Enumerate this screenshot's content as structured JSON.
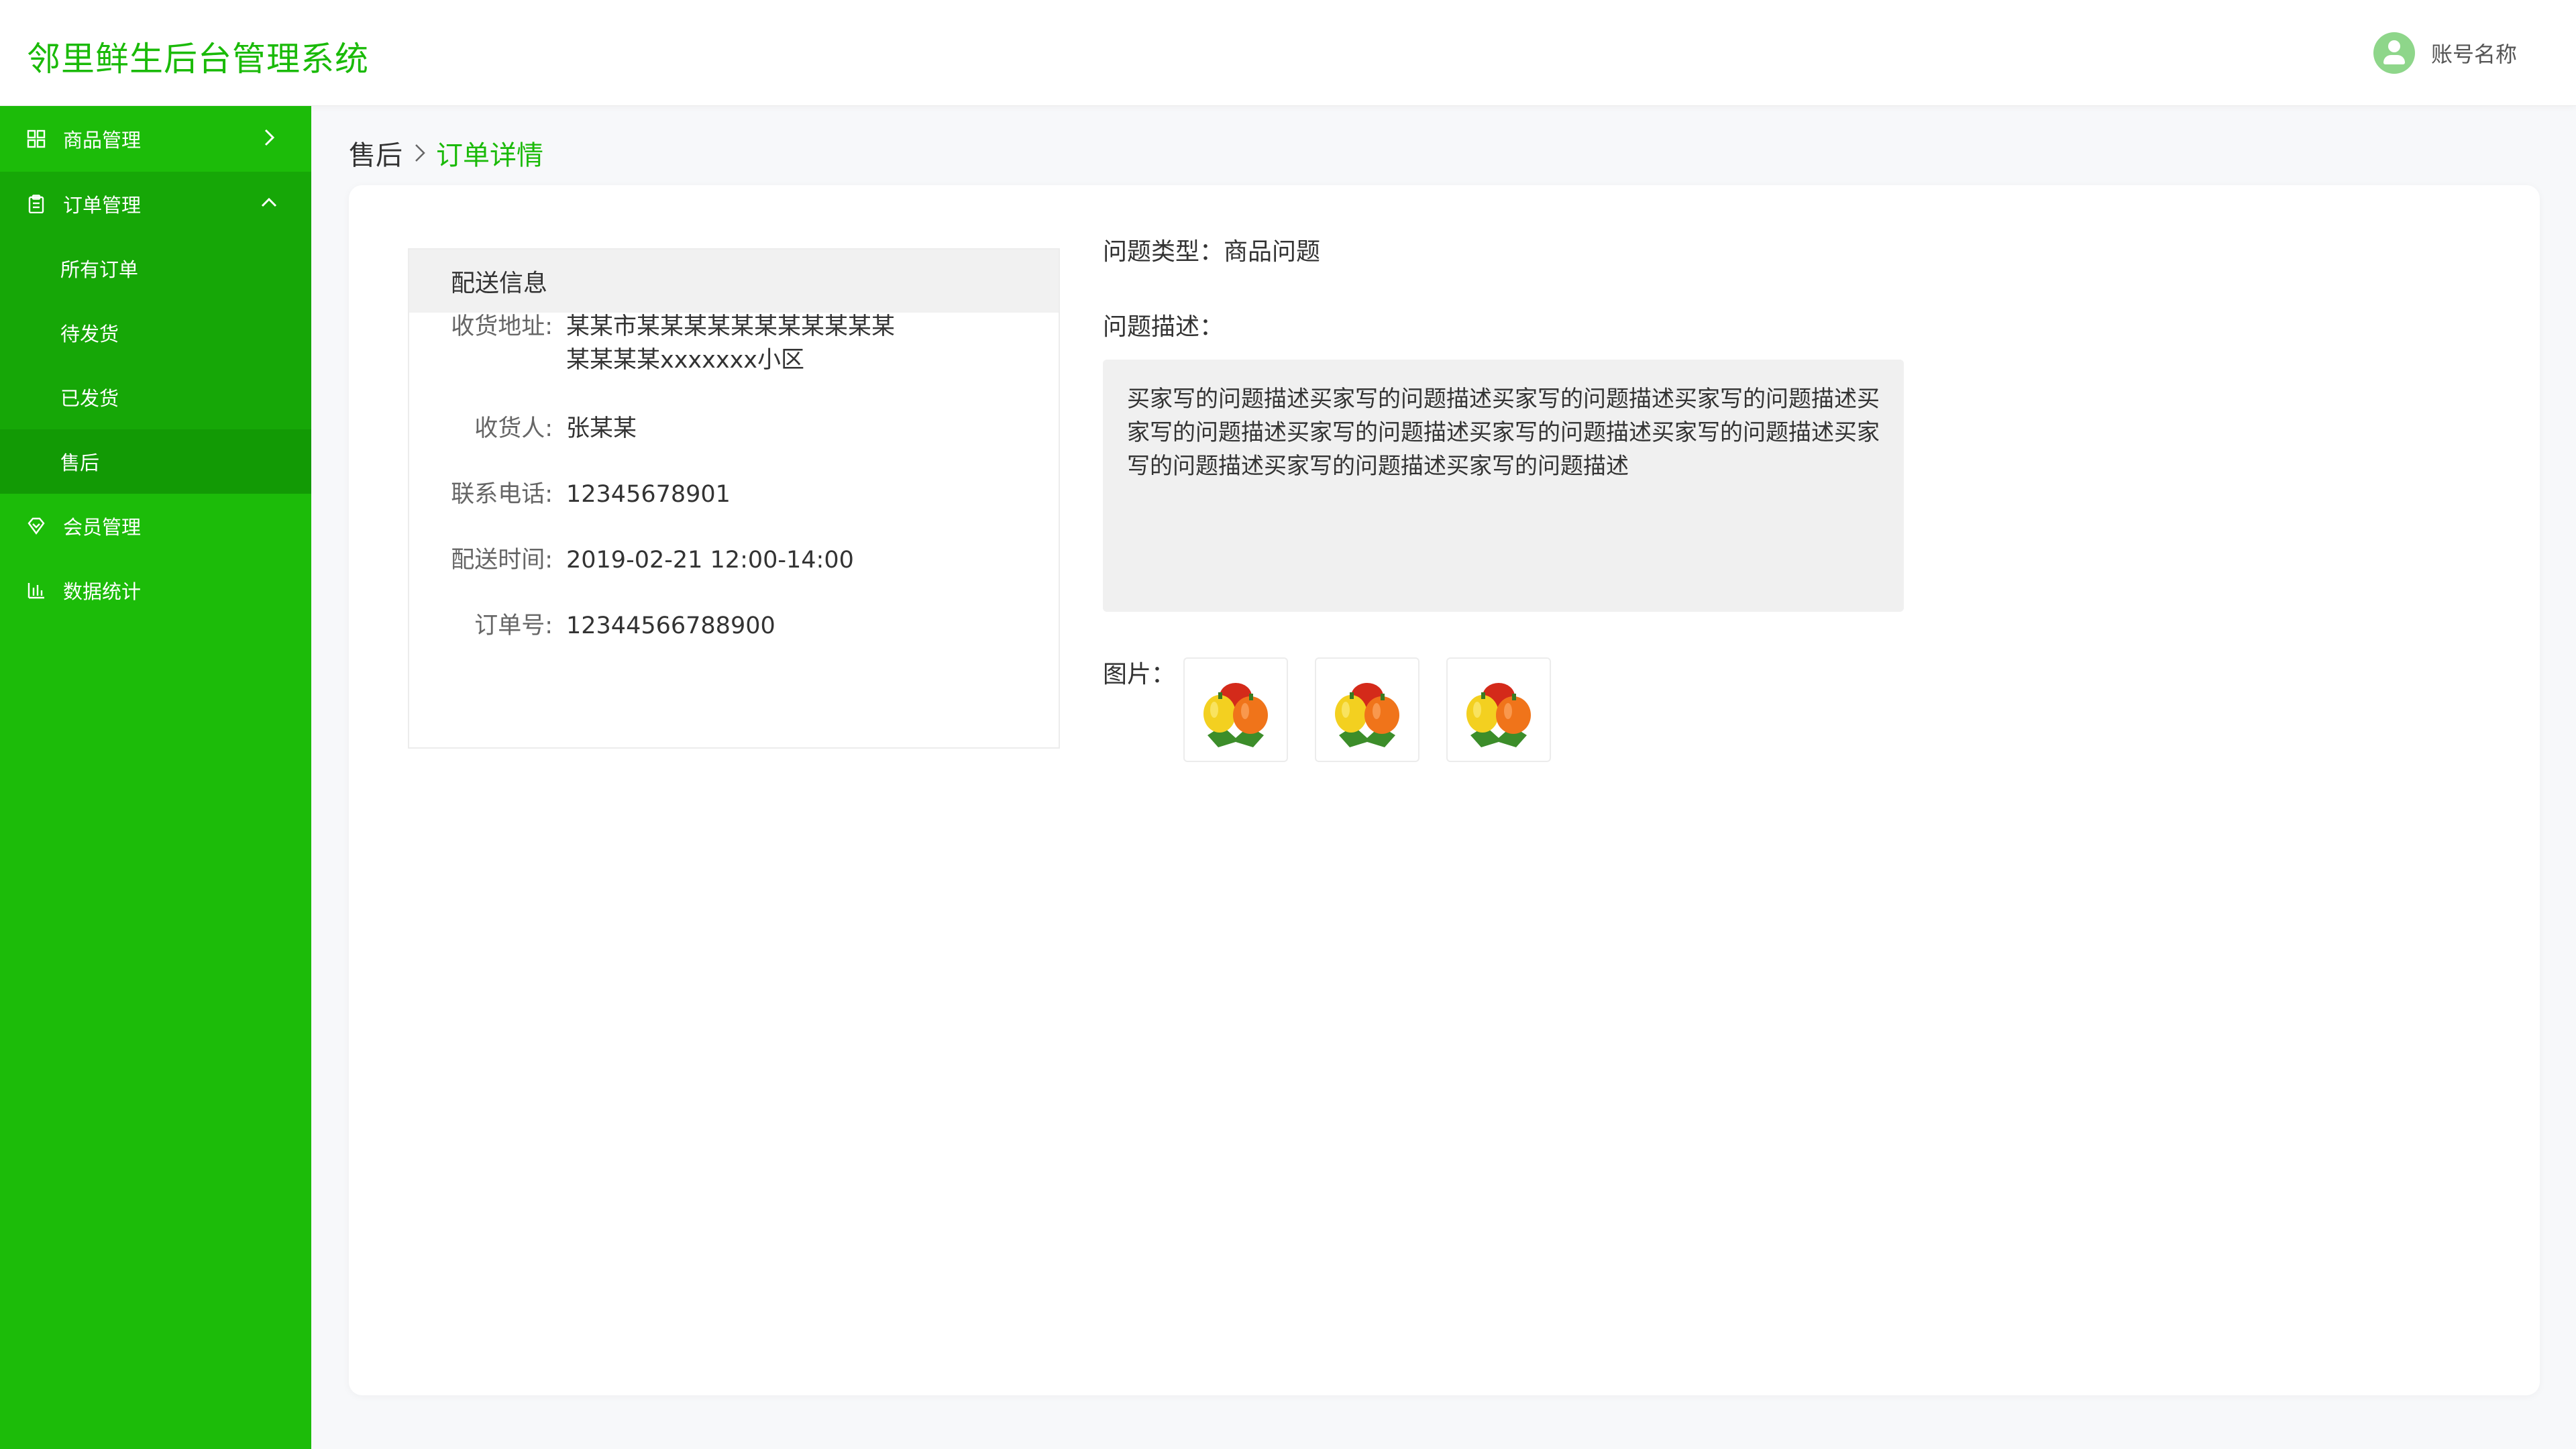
{
  "header": {
    "app_title": "邻里鲜生后台管理系统",
    "account_name": "账号名称"
  },
  "sidebar": {
    "items": [
      {
        "label": "商品管理",
        "icon": "grid-icon"
      },
      {
        "label": "订单管理",
        "icon": "clipboard-icon",
        "expanded": true,
        "children": [
          {
            "label": "所有订单"
          },
          {
            "label": "待发货"
          },
          {
            "label": "已发货"
          },
          {
            "label": "售后",
            "active": true
          }
        ]
      },
      {
        "label": "会员管理",
        "icon": "diamond-icon"
      },
      {
        "label": "数据统计",
        "icon": "bar-chart-icon"
      }
    ]
  },
  "breadcrumb": {
    "parent": "售后",
    "current": "订单详情"
  },
  "delivery": {
    "title": "配送信息",
    "rows": [
      {
        "label": "收货地址:",
        "value": "某某市某某某某某某某某某某某某某某某xxxxxxx小区"
      },
      {
        "label": "收货人:",
        "value": "张某某"
      },
      {
        "label": "联系电话:",
        "value": "12345678901"
      },
      {
        "label": "配送时间:",
        "value": "2019-02-21 12:00-14:00"
      },
      {
        "label": "订单号:",
        "value": "12344566788900"
      }
    ]
  },
  "problem": {
    "type_text": "问题类型：商品问题",
    "desc_label": "问题描述：",
    "desc_text": "买家写的问题描述买家写的问题描述买家写的问题描述买家写的问题描述买家写的问题描述买家写的问题描述买家写的问题描述买家写的问题描述买家写的问题描述买家写的问题描述买家写的问题描述",
    "images_label": "图片：",
    "image_count": 3
  },
  "colors": {
    "brand": "#1aba08",
    "sidebar": "#1cbc09",
    "sidebar_active": "#16a707"
  }
}
